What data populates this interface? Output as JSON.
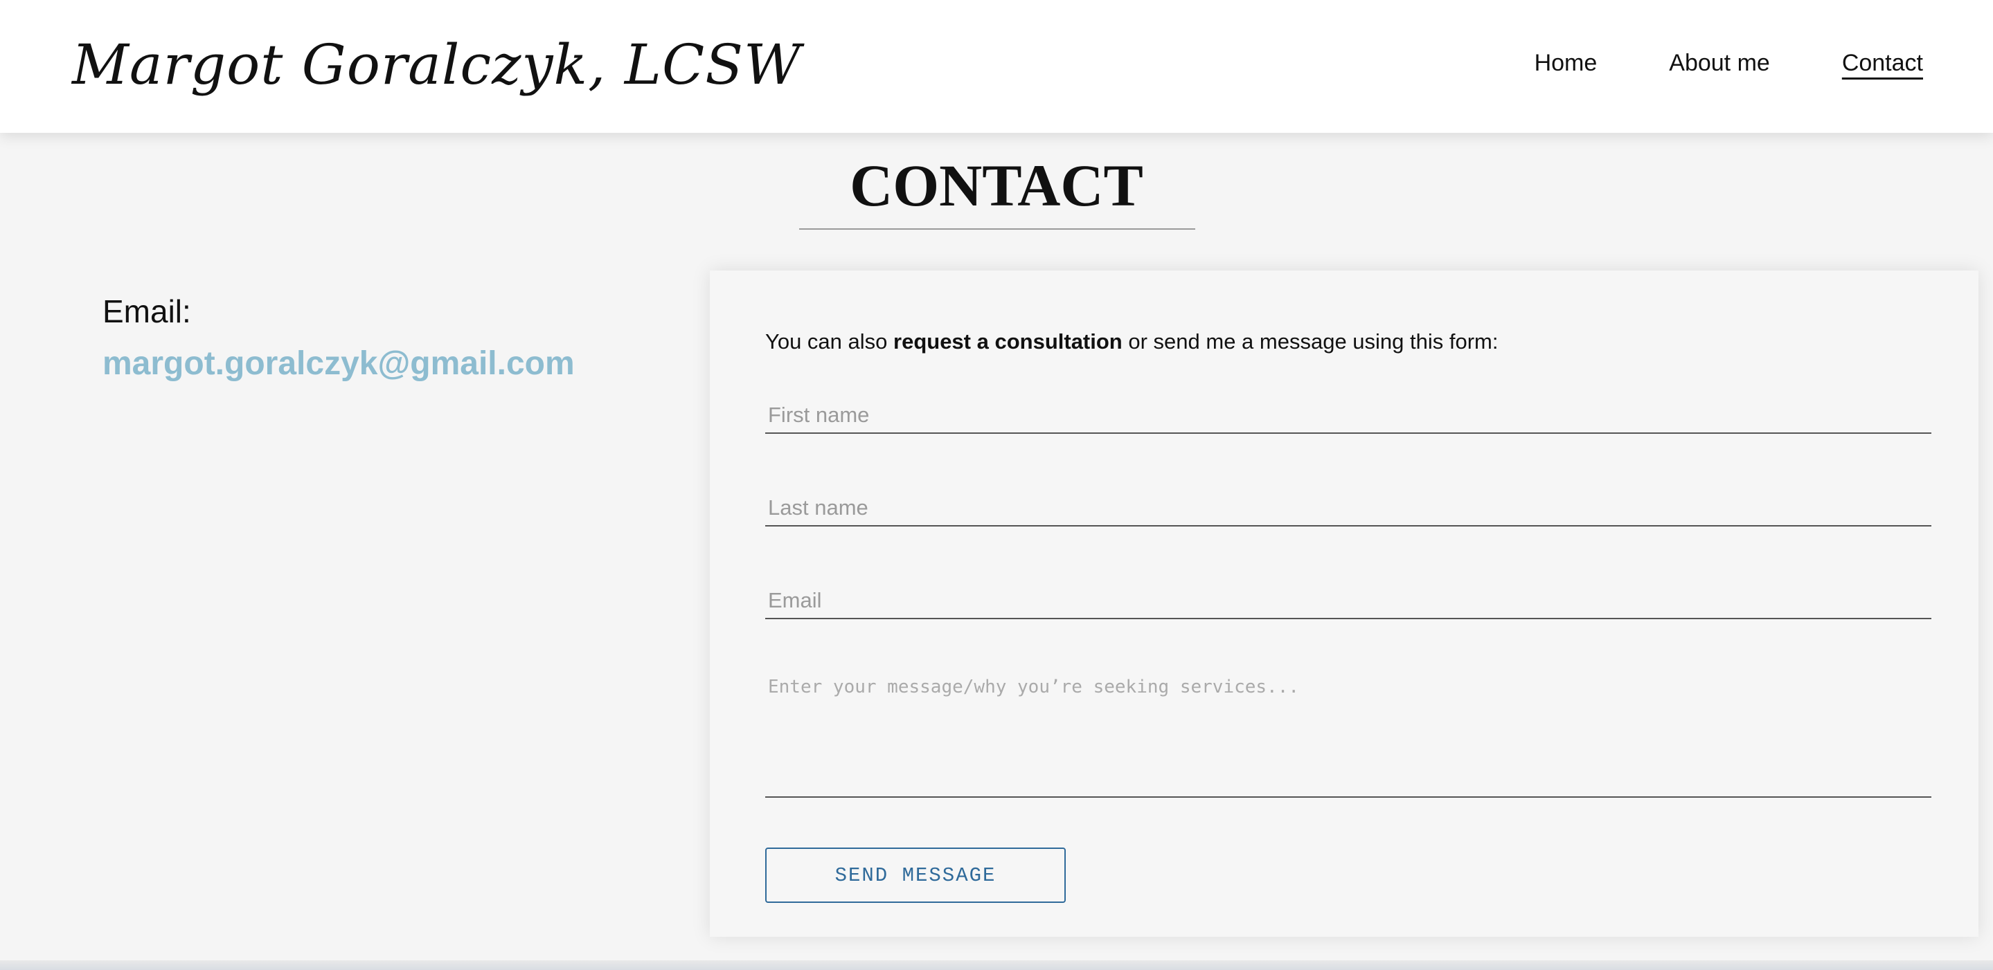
{
  "header": {
    "logo": "Margot Goralczyk, LCSW",
    "nav": [
      {
        "label": "Home"
      },
      {
        "label": "About me"
      },
      {
        "label": "Contact"
      }
    ]
  },
  "page": {
    "title": "CONTACT"
  },
  "contact": {
    "email_label": "Email:",
    "email_value": "margot.goralczyk@gmail.com"
  },
  "form": {
    "intro_before": "You can also ",
    "intro_bold": "request a consultation",
    "intro_after": " or send me a message using this form:",
    "first_name_placeholder": "First name",
    "last_name_placeholder": "Last name",
    "email_placeholder": "Email",
    "message_placeholder": "Enter your message/why you’re seeking services...",
    "submit_label": "SEND MESSAGE"
  },
  "colors": {
    "accent_link": "#8dbcd0",
    "button": "#2f6a9a",
    "background": "#f5f5f5"
  }
}
